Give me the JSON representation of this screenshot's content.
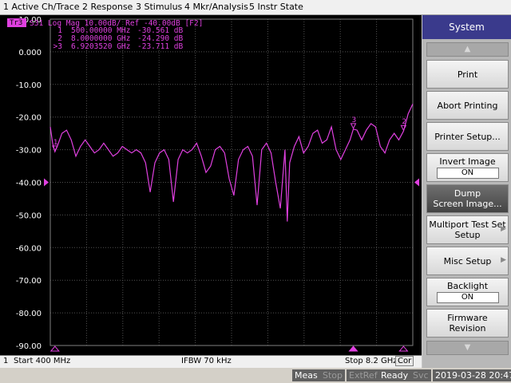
{
  "menu": [
    "1 Active Ch/Trace",
    "2 Response",
    "3 Stimulus",
    "4 Mkr/Analysis",
    "5 Instr State"
  ],
  "trace_header": {
    "badge": "Tr3",
    "text": "S31 Log Mag 10.00dB/ Ref -40.00dB [F2]"
  },
  "markers": [
    {
      "id": "1",
      "freq": "500.00000 MHz",
      "value": "-30.561 dB"
    },
    {
      "id": "2",
      "freq": "8.0000000 GHz",
      "value": "-24.290 dB"
    },
    {
      "id": ">3",
      "freq": "6.9203520 GHz",
      "value": "-23.711 dB"
    }
  ],
  "chart_data": {
    "type": "line",
    "ylabels": [
      "10.00",
      "0.000",
      "-10.00",
      "-20.00",
      "-30.00",
      "-40.00",
      "-50.00",
      "-60.00",
      "-70.00",
      "-80.00",
      "-90.00"
    ],
    "ylim": [
      -90,
      10
    ],
    "xlim_ghz": [
      0.4,
      8.2
    ],
    "ref_level": -40,
    "trace_color": "#e040e0",
    "series": [
      {
        "x_ghz": [
          0.4,
          0.45,
          0.5,
          0.55,
          0.65,
          0.75,
          0.85,
          0.95,
          1.05,
          1.15,
          1.25,
          1.35,
          1.45,
          1.55,
          1.65,
          1.75,
          1.85,
          1.95,
          2.05,
          2.15,
          2.25,
          2.35,
          2.45,
          2.55,
          2.65,
          2.75,
          2.85,
          2.95,
          3.05,
          3.15,
          3.25,
          3.35,
          3.45,
          3.55,
          3.65,
          3.75,
          3.85,
          3.95,
          4.05,
          4.15,
          4.25,
          4.35,
          4.45,
          4.55,
          4.65,
          4.75,
          4.85,
          4.95,
          5.05,
          5.15,
          5.25,
          5.35,
          5.45,
          5.5,
          5.55,
          5.65,
          5.75,
          5.85,
          5.95,
          6.05,
          6.15,
          6.25,
          6.35,
          6.45,
          6.55,
          6.65,
          6.75,
          6.85,
          6.92,
          7.0,
          7.1,
          7.2,
          7.3,
          7.4,
          7.5,
          7.6,
          7.7,
          7.8,
          7.9,
          8.0,
          8.1,
          8.2
        ],
        "y_db": [
          -23,
          -28,
          -30.6,
          -29,
          -25,
          -24,
          -27,
          -32,
          -29,
          -27,
          -29,
          -31,
          -30,
          -28,
          -30,
          -32,
          -31,
          -29,
          -30,
          -31,
          -30,
          -31,
          -34,
          -43,
          -34,
          -31,
          -30,
          -33,
          -46,
          -33,
          -30,
          -31,
          -30,
          -28,
          -32,
          -37,
          -35,
          -30,
          -29,
          -31,
          -39,
          -44,
          -33,
          -30,
          -29,
          -32,
          -47,
          -30,
          -28,
          -31,
          -40,
          -48,
          -30,
          -52,
          -34,
          -29,
          -26,
          -31,
          -29,
          -25,
          -24,
          -28,
          -27,
          -23,
          -30,
          -33,
          -30,
          -27,
          -23.7,
          -24,
          -27,
          -24,
          -22,
          -23,
          -29,
          -31,
          -27,
          -25,
          -27,
          -24.3,
          -19,
          -16
        ]
      }
    ]
  },
  "channel_bar": {
    "channel": "1",
    "start": "Start 400 MHz",
    "ifbw": "IFBW 70 kHz",
    "stop": "Stop 8.2 GHz",
    "cor": "Cor"
  },
  "status_bar": {
    "items": [
      "Meas",
      "Stop",
      "ExtRef",
      "Ready",
      "Svc"
    ],
    "datetime": "2019-03-28 20:47"
  },
  "softkeys": {
    "title": "System",
    "keys": [
      {
        "label": "Print"
      },
      {
        "label": "Abort Printing"
      },
      {
        "label": "Printer Setup..."
      },
      {
        "label": "Invert Image",
        "value": "ON"
      },
      {
        "label": "Dump\nScreen Image...",
        "active": true
      },
      {
        "label": "Multiport Test Set\nSetup",
        "arrow": true
      },
      {
        "label": "Misc Setup",
        "arrow": true
      },
      {
        "label": "Backlight",
        "value": "ON"
      },
      {
        "label": "Firmware\nRevision"
      }
    ]
  }
}
